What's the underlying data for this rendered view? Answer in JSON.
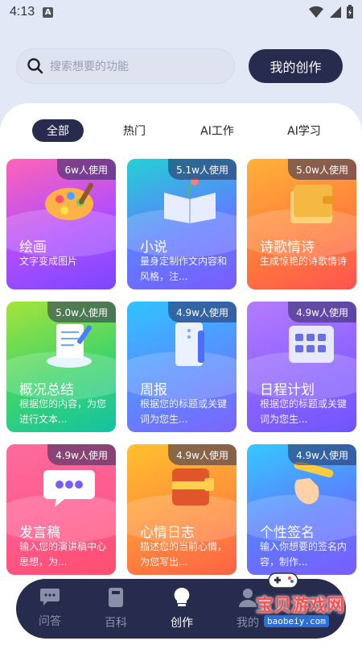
{
  "status": {
    "time": "4:13",
    "badge": "A"
  },
  "search": {
    "placeholder": "搜索想要的功能"
  },
  "header": {
    "mine_label": "我的创作"
  },
  "tabs": [
    {
      "label": "全部",
      "active": true
    },
    {
      "label": "热门",
      "active": false
    },
    {
      "label": "AI工作",
      "active": false
    },
    {
      "label": "AI学习",
      "active": false
    }
  ],
  "cards": [
    {
      "usage": "6w人使用",
      "title": "绘画",
      "desc": "文字变成图片",
      "icon": "paint-palette-icon"
    },
    {
      "usage": "5.1w人使用",
      "title": "小说",
      "desc": "量身定制作文内容和风格，注...",
      "icon": "open-book-icon"
    },
    {
      "usage": "5.0w人使用",
      "title": "诗歌情诗",
      "desc": "生成惊艳的诗歌情诗",
      "icon": "notebook-icon"
    },
    {
      "usage": "5.0w人使用",
      "title": "概况总结",
      "desc": "根据您的内容，为您进行文本...",
      "icon": "document-cloud-icon"
    },
    {
      "usage": "4.9w人使用",
      "title": "周报",
      "desc": "根据您的标题或关键词为您生...",
      "icon": "clipboard-icon"
    },
    {
      "usage": "4.9w人使用",
      "title": "日程计划",
      "desc": "根据您的标题或关键词为您生...",
      "icon": "calendar-icon"
    },
    {
      "usage": "4.9w人使用",
      "title": "发言稿",
      "desc": "输入您的演讲稿中心思想，为...",
      "icon": "chat-bubble-icon"
    },
    {
      "usage": "4.9w人使用",
      "title": "心情日志",
      "desc": "描述您的当前心情，为您写出...",
      "icon": "diary-icon"
    },
    {
      "usage": "4.9w人使用",
      "title": "个性签名",
      "desc": "输入你想要的签名内容，制作...",
      "icon": "pencil-hand-icon"
    }
  ],
  "nav": [
    {
      "label": "问答",
      "icon": "chat-icon",
      "active": false
    },
    {
      "label": "百科",
      "icon": "book-icon",
      "active": false
    },
    {
      "label": "创作",
      "icon": "lightbulb-icon",
      "active": true
    },
    {
      "label": "我的",
      "icon": "user-icon",
      "active": false
    }
  ],
  "watermark": {
    "title": "宝贝游戏网",
    "url": "baobeiy.com"
  },
  "colors": {
    "dark": "#272b4d",
    "background": "#e3e8f6"
  }
}
